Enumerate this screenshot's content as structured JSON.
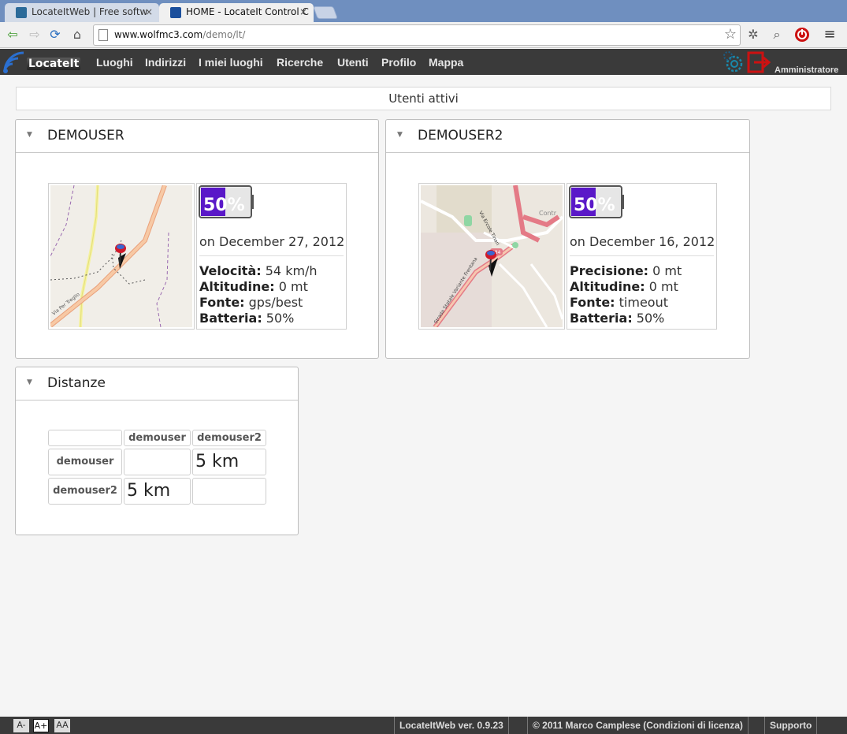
{
  "browser": {
    "tabs": [
      {
        "title": "LocateItWeb | Free softw",
        "close": "×"
      },
      {
        "title": "HOME - LocateIt Control C",
        "close": "×"
      }
    ],
    "url_host": "www.wolfmc3.com",
    "url_path": "/demo/lt/"
  },
  "app": {
    "logo_text": "LocateIt",
    "nav": [
      "Luoghi",
      "Indirizzi",
      "I miei luoghi",
      "Ricerche",
      "Utenti",
      "Profilo",
      "Mappa"
    ],
    "admin_label": "Amministratore"
  },
  "page": {
    "title": "Utenti attivi"
  },
  "users": [
    {
      "name": "DEMOUSER",
      "battery_text": "50%",
      "battery_level": 0.5,
      "date": "on December 27, 2012",
      "details": [
        {
          "label": "Velocità:",
          "value": " 54 km/h"
        },
        {
          "label": "Altitudine:",
          "value": " 0 mt"
        },
        {
          "label": "Fonte:",
          "value": " gps/best"
        },
        {
          "label": "Batteria:",
          "value": " 50%"
        }
      ],
      "map_street": "Via Per Treglio"
    },
    {
      "name": "DEMOUSER2",
      "battery_text": "50%",
      "battery_level": 0.5,
      "date": "on December 16, 2012",
      "details": [
        {
          "label": "Precisione:",
          "value": " 0 mt"
        },
        {
          "label": "Altitudine:",
          "value": " 0 mt"
        },
        {
          "label": "Fonte:",
          "value": " timeout"
        },
        {
          "label": "Batteria:",
          "value": " 50%"
        }
      ],
      "map_street": "Strada Statale Variante Frentana",
      "map_labels": [
        "Via Ercole Tinari",
        "Contr",
        "S84"
      ]
    }
  ],
  "distances": {
    "title": "Distanze",
    "cols": [
      "demouser",
      "demouser2"
    ],
    "rows": [
      {
        "name": "demouser",
        "values": [
          "",
          "5 km"
        ]
      },
      {
        "name": "demouser2",
        "values": [
          "5 km",
          ""
        ]
      }
    ]
  },
  "footer": {
    "font_buttons": [
      "A-",
      "A+",
      "AA"
    ],
    "version": "LocateItWeb ver. 0.9.23",
    "copyright": "© 2011 Marco Camplese (Condizioni di licenza)",
    "support": "Supporto"
  },
  "colors": {
    "nav_bg": "#3a3a3a",
    "battery_fill": "#5a18c8",
    "exit_red": "#cc1111",
    "gear_blue": "#1a88aa"
  }
}
